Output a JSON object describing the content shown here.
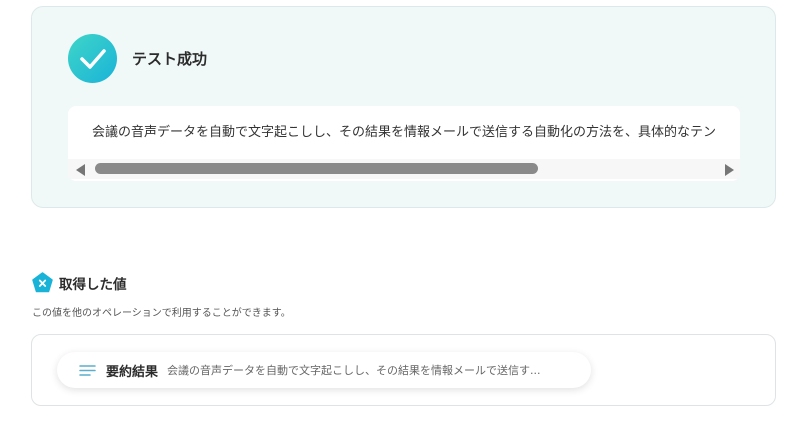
{
  "success": {
    "title": "テスト成功",
    "result_text": "会議の音声データを自動で文字起こしし、その結果を情報メールで送信する自動化の方法を、具体的なテン"
  },
  "obtained": {
    "title": "取得した値",
    "description": "この値を他のオペレーションで利用することができます。",
    "items": [
      {
        "label": "要約結果",
        "value": "会議の音声データを自動で文字起こしし、その結果を情報メールで送信す..."
      }
    ]
  },
  "colors": {
    "accent_gradient_start": "#3fd5c8",
    "accent_gradient_end": "#1ab3d8",
    "badge_color": "#1ab3d8",
    "card_background": "#f0f9f8"
  },
  "icons": {
    "success": "check-circle-icon",
    "section": "pentagon-x-icon",
    "item": "text-lines-icon"
  }
}
